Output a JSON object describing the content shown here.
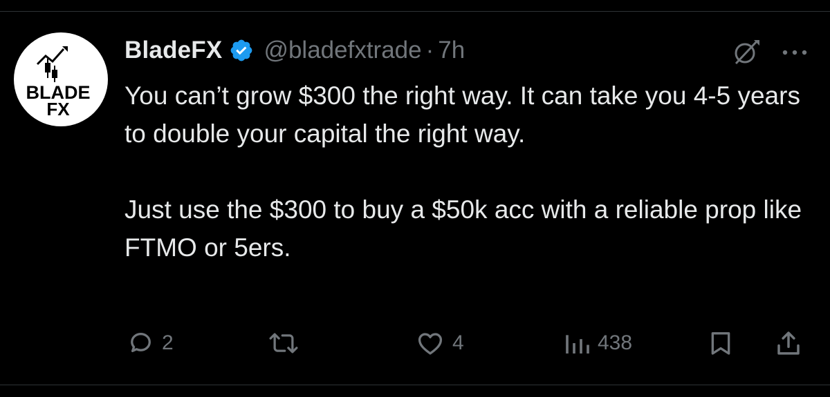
{
  "author": {
    "display_name": "BladeFX",
    "handle": "@bladefxtrade",
    "separator": "·",
    "time": "7h",
    "avatar_text_line1": "BLADE",
    "avatar_text_line2": "FX"
  },
  "tweet": {
    "paragraph1": "You can’t grow $300 the right way. It can take you 4-5 years to double your capital the right way.",
    "paragraph2": "Just use the $300 to buy a $50k acc with a reliable prop like FTMO or 5ers."
  },
  "actions": {
    "replies": "2",
    "retweets": "",
    "likes": "4",
    "views": "438"
  },
  "icons": {
    "verified": "verified-badge-icon",
    "grok": "grok-icon",
    "more": "more-icon",
    "reply": "reply-icon",
    "retweet": "retweet-icon",
    "like": "heart-icon",
    "views": "views-icon",
    "bookmark": "bookmark-icon",
    "share": "share-icon"
  },
  "colors": {
    "background": "#000000",
    "text": "#e7e9ea",
    "muted": "#71767b",
    "verified": "#1d9bf0"
  }
}
